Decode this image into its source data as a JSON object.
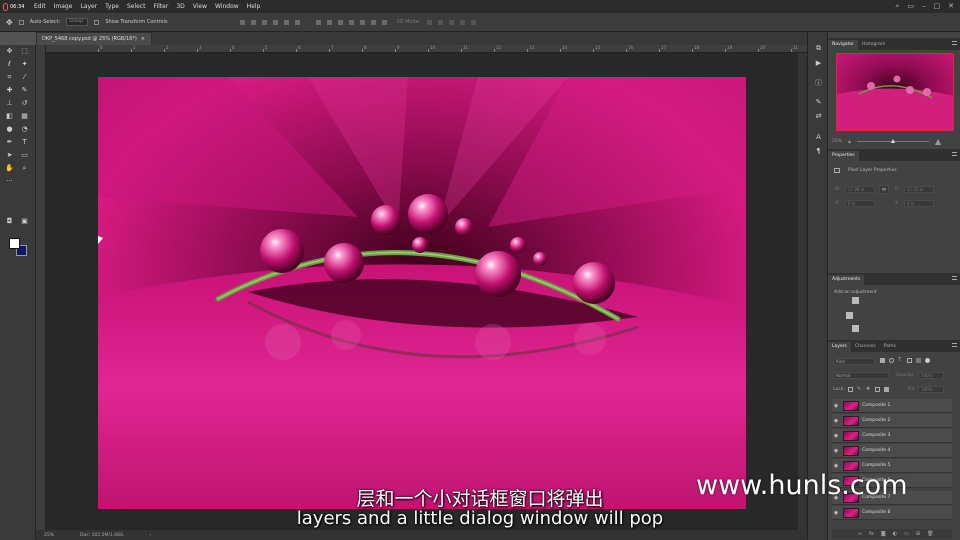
{
  "menubar": {
    "clock": "06:34",
    "items": [
      "Edit",
      "Image",
      "Layer",
      "Type",
      "Select",
      "Filter",
      "3D",
      "View",
      "Window",
      "Help"
    ]
  },
  "options": {
    "auto_select_label": "Auto-Select:",
    "auto_select_value": "Group",
    "transform_label": "Show Transform Controls",
    "mode_3d_label": "3D Mode:"
  },
  "document": {
    "tab_title": "DKP_5468 copy.psd @ 25% (RGB/16*)",
    "zoom": "25%",
    "doc_size": "Doc: 102.5M/1.08G"
  },
  "rulers": {
    "top_numbers": [
      "0",
      "1",
      "2",
      "3",
      "4",
      "5",
      "6",
      "7",
      "8",
      "9",
      "10",
      "11",
      "12",
      "13",
      "14",
      "15",
      "16",
      "17",
      "18",
      "19",
      "20",
      "21"
    ]
  },
  "panels": {
    "navigator_tab": "Navigator",
    "histogram_tab": "Histogram",
    "nav_zoom": "25%",
    "properties_tab": "Properties",
    "pixel_layer_label": "Pixel Layer Properties",
    "w_label": "W:",
    "w_value": "17.28 in",
    "h_label": "H:",
    "h_value": "11.52 in",
    "x_label": "X:",
    "x_value": "0 in",
    "y_label": "Y:",
    "y_value": "0 in",
    "adjustments_tab": "Adjustments",
    "add_adjustment_label": "Add an adjustment",
    "layers_tab": "Layers",
    "channels_tab": "Channels",
    "paths_tab": "Paths",
    "kind_label": "Kind",
    "blend_mode": "Normal",
    "opacity_label": "Opacity:",
    "opacity_value": "100%",
    "lock_label": "Lock:",
    "fill_label": "Fill:",
    "fill_value": "100%",
    "layers": [
      "Composite 1",
      "Composite 2",
      "Composite 3",
      "Composite 4",
      "Composite 5",
      "Composite 6",
      "Composite 7",
      "Composite 8"
    ]
  },
  "subtitles": {
    "chinese": "层和一个小对话框窗口将弹出",
    "english": "layers and a little dialog window will pop"
  },
  "watermark": "www.hunls.com",
  "colors": {
    "foreground": "#ffffff",
    "background": "#0a1a6a",
    "flower": "#d0187a",
    "stem": "#6aa040"
  }
}
